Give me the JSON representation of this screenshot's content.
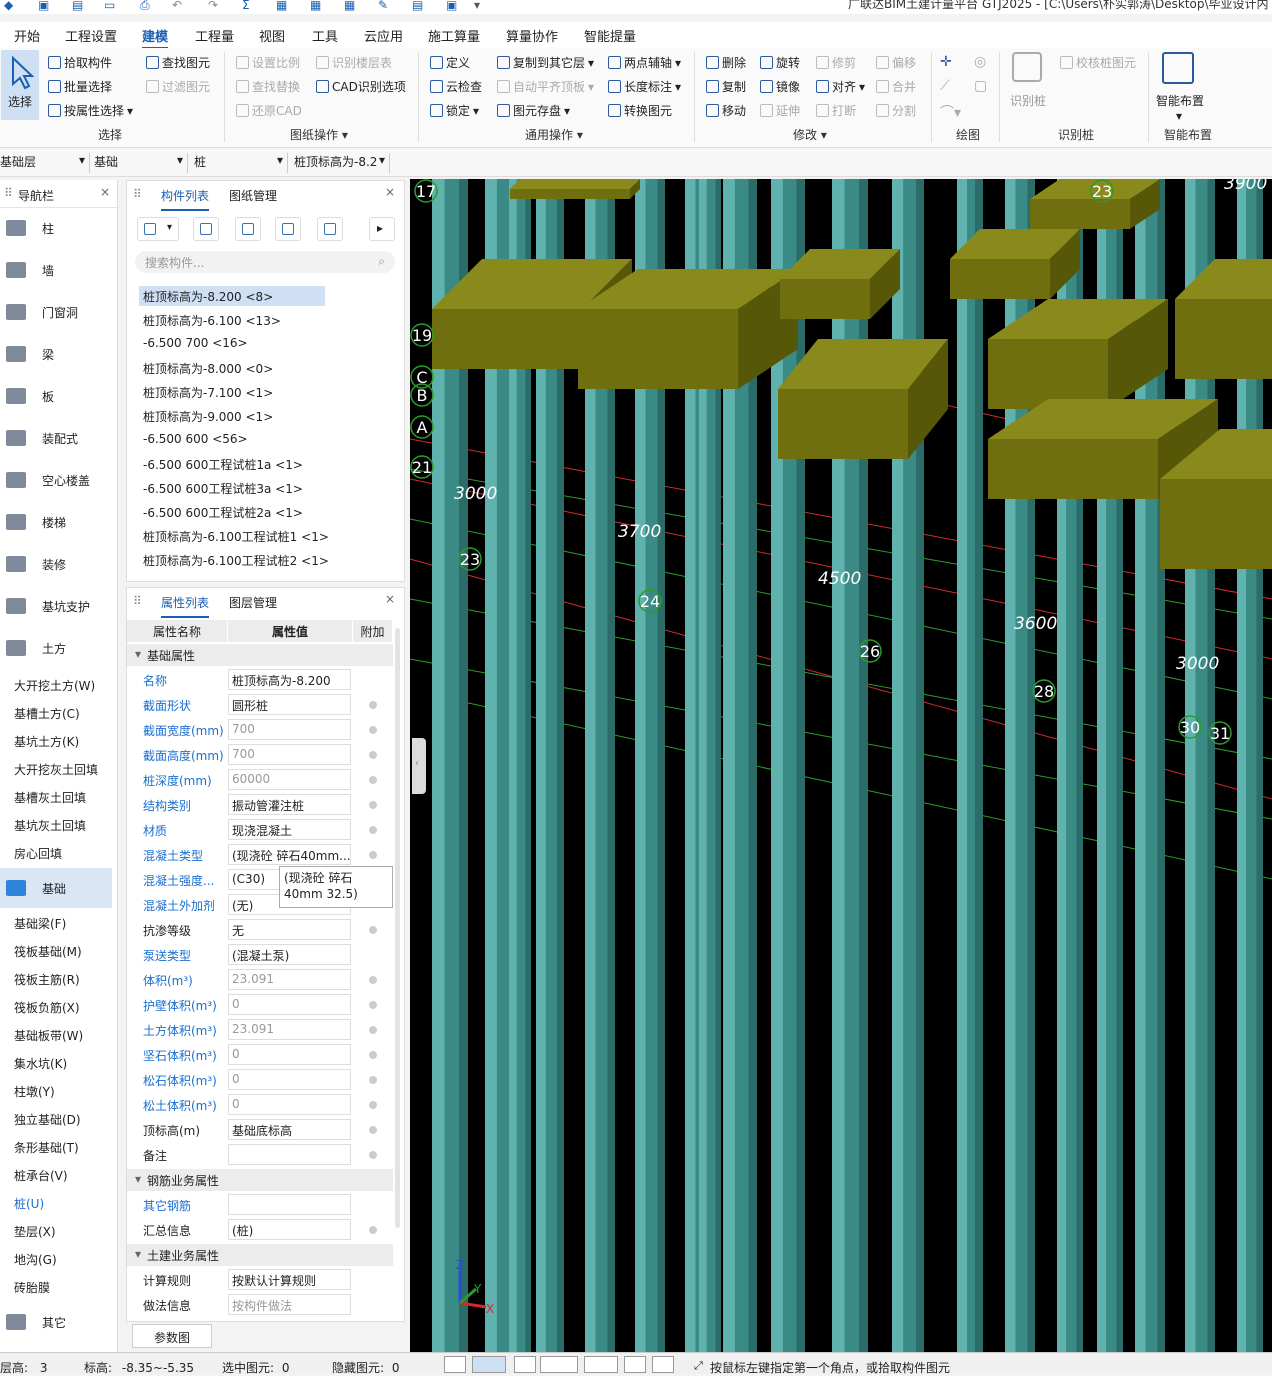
{
  "app": {
    "title": "广联达BIM土建计量平台 GTJ2025 - [C:\\Users\\朴实郭涛\\Desktop\\毕业设计内"
  },
  "menu": [
    "开始",
    "工程设置",
    "建模",
    "工程量",
    "视图",
    "工具",
    "云应用",
    "施工算量",
    "算量协作",
    "智能提量"
  ],
  "ribbon": {
    "select": "选择",
    "pick": "拾取构件",
    "batch": "批量选择",
    "byattr": "按属性选择",
    "find": "查找图元",
    "filter": "过滤图元",
    "scale": "设置比例",
    "findreplace": "查找替换",
    "restorecad": "还原CAD",
    "floorid": "识别楼层表",
    "cadopt": "CAD识别选项",
    "define": "定义",
    "cloudcheck": "云检查",
    "lock": "锁定",
    "copyto": "复制到其它层",
    "autoflush": "自动平齐顶板",
    "store": "图元存盘",
    "twoaxis": "两点辅轴",
    "dimlen": "长度标注",
    "convert": "转换图元",
    "delete": "删除",
    "copy": "复制",
    "move": "移动",
    "rotate": "旋转",
    "mirror": "镜像",
    "extend": "延伸",
    "trim": "修剪",
    "align": "对齐",
    "break": "打断",
    "offset": "偏移",
    "merge": "合并",
    "split": "分割",
    "idpile": "识别桩",
    "checkpile": "校核桩图元",
    "smart": "智能布置",
    "groups": [
      "选择",
      "图纸操作",
      "通用操作",
      "修改",
      "绘图",
      "识别桩",
      "智能布置"
    ]
  },
  "toolbar": {
    "floor": "基础层",
    "type": "基础",
    "sub": "桩",
    "item": "桩顶标高为-8.2"
  },
  "nav": {
    "title": "导航栏",
    "cats": [
      "柱",
      "墙",
      "门窗洞",
      "梁",
      "板",
      "装配式",
      "空心楼盖",
      "楼梯",
      "装修",
      "基坑支护",
      "土方"
    ],
    "soil": [
      "大开挖土方(W)",
      "基槽土方(C)",
      "基坑土方(K)",
      "大开挖灰土回填",
      "基槽灰土回填",
      "基坑灰土回填",
      "房心回填"
    ],
    "found": "基础",
    "foundsub": [
      "基础梁(F)",
      "筏板基础(M)",
      "筏板主筋(R)",
      "筏板负筋(X)",
      "基础板带(W)",
      "集水坑(K)",
      "柱墩(Y)",
      "独立基础(D)",
      "条形基础(T)",
      "桩承台(V)",
      "桩(U)",
      "垫层(X)",
      "地沟(G)",
      "砖胎膜"
    ],
    "other": "其它"
  },
  "complist": {
    "tab1": "构件列表",
    "tab2": "图纸管理",
    "search": "搜索构件...",
    "items": [
      "桩顶标高为-8.200 <8>",
      "桩顶标高为-6.100 <13>",
      "-6.500  700 <16>",
      "桩顶标高为-8.000 <0>",
      "桩顶标高为-7.100 <1>",
      "桩顶标高为-9.000 <1>",
      "-6.500  600 <56>",
      "-6.500  600工程试桩1a <1>",
      "-6.500  600工程试桩3a <1>",
      "-6.500  600工程试桩2a <1>",
      "桩顶标高为-6.100工程试桩1 <1>",
      "桩顶标高为-6.100工程试桩2 <1>"
    ]
  },
  "props": {
    "tab1": "属性列表",
    "tab2": "图层管理",
    "cols": [
      "属性名称",
      "属性值",
      "附加"
    ],
    "sec1": "基础属性",
    "sec2": "钢筋业务属性",
    "sec3": "土建业务属性",
    "rows": [
      {
        "n": "名称",
        "v": "桩顶标高为-8.200",
        "blue": true,
        "gray": false,
        "a": false
      },
      {
        "n": "截面形状",
        "v": "圆形桩",
        "blue": true,
        "gray": false,
        "a": true
      },
      {
        "n": "截面宽度(mm)",
        "v": "700",
        "blue": true,
        "gray": true,
        "a": true
      },
      {
        "n": "截面高度(mm)",
        "v": "700",
        "blue": true,
        "gray": true,
        "a": true
      },
      {
        "n": "桩深度(mm)",
        "v": "60000",
        "blue": true,
        "gray": true,
        "a": true
      },
      {
        "n": "结构类别",
        "v": "振动管灌注桩",
        "blue": true,
        "gray": false,
        "a": true
      },
      {
        "n": "材质",
        "v": "现浇混凝土",
        "blue": true,
        "gray": false,
        "a": true
      },
      {
        "n": "混凝土类型",
        "v": "(现浇砼 碎石40mm...",
        "blue": true,
        "gray": false,
        "a": true
      },
      {
        "n": "混凝土强度...",
        "v": "(C30)",
        "blue": true,
        "gray": false,
        "a": false
      },
      {
        "n": "混凝土外加剂",
        "v": "(无)",
        "blue": true,
        "gray": false,
        "a": false
      },
      {
        "n": "抗渗等级",
        "v": "无",
        "blue": false,
        "gray": false,
        "a": true
      },
      {
        "n": "泵送类型",
        "v": "(混凝土泵)",
        "blue": true,
        "gray": false,
        "a": false
      },
      {
        "n": "体积(m³)",
        "v": "23.091",
        "blue": true,
        "gray": true,
        "a": true
      },
      {
        "n": "护壁体积(m³)",
        "v": "0",
        "blue": true,
        "gray": true,
        "a": true
      },
      {
        "n": "土方体积(m³)",
        "v": "23.091",
        "blue": true,
        "gray": true,
        "a": true
      },
      {
        "n": "坚石体积(m³)",
        "v": "0",
        "blue": true,
        "gray": true,
        "a": true
      },
      {
        "n": "松石体积(m³)",
        "v": "0",
        "blue": true,
        "gray": true,
        "a": true
      },
      {
        "n": "松土体积(m³)",
        "v": "0",
        "blue": true,
        "gray": true,
        "a": true
      },
      {
        "n": "顶标高(m)",
        "v": "基础底标高",
        "blue": false,
        "gray": false,
        "a": true
      },
      {
        "n": "备注",
        "v": "",
        "blue": false,
        "gray": false,
        "a": true
      }
    ],
    "rows2": [
      {
        "n": "其它钢筋",
        "v": "",
        "blue": true,
        "a": false
      },
      {
        "n": "汇总信息",
        "v": "(桩)",
        "blue": false,
        "a": true
      }
    ],
    "rows3": [
      {
        "n": "计算规则",
        "v": "按默认计算规则",
        "gray": false
      },
      {
        "n": "做法信息",
        "v": "按构件做法",
        "gray": true
      }
    ],
    "tooltip": "(现浇砼 碎石40mm 32.5)",
    "param": "参数图"
  },
  "view": {
    "dims": [
      "3000",
      "3700",
      "4500",
      "3600",
      "3000",
      "3900"
    ],
    "axes": [
      "17",
      "19",
      "C",
      "B",
      "A",
      "21",
      "23",
      "24",
      "26",
      "28",
      "30",
      "31",
      "23"
    ],
    "axisx": "X",
    "axisy": "Y",
    "axisz": "Z"
  },
  "status": {
    "floor_label": "层高:",
    "floor_val": "3",
    "elev_label": "标高:",
    "elev_val": "-8.35~-5.35",
    "sel_label": "选中图元:",
    "sel_val": "0",
    "hid_label": "隐藏图元:",
    "hid_val": "0",
    "hint": "按鼠标左键指定第一个角点，或拾取构件图元"
  }
}
